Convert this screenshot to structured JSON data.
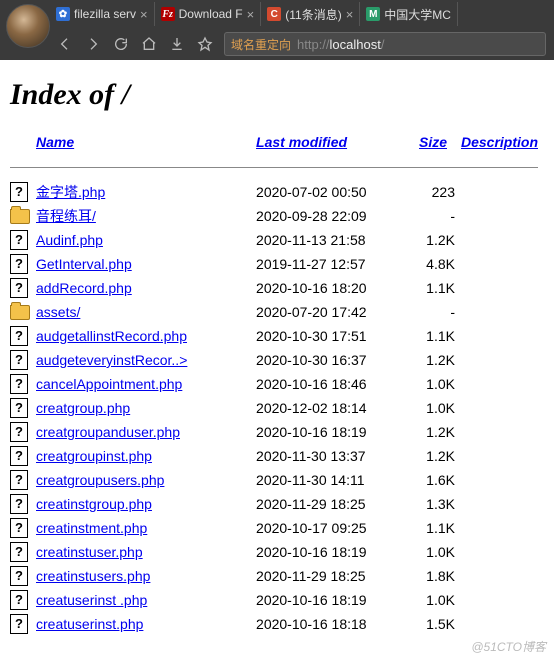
{
  "browser": {
    "tabs": [
      {
        "favicon": "baidu",
        "label": "filezilla serv"
      },
      {
        "favicon": "fz",
        "label": "Download F"
      },
      {
        "favicon": "c",
        "label": "(11条消息)"
      },
      {
        "favicon": "mooc",
        "label": "中国大学MC"
      }
    ],
    "url_redirect_label": "域名重定向",
    "url_scheme": "http://",
    "url_host": "localhost",
    "url_path": "/"
  },
  "page": {
    "heading": "Index of /",
    "columns": {
      "name": "Name",
      "modified": "Last modified",
      "size": "Size",
      "description": "Description"
    },
    "rows": [
      {
        "icon": "file",
        "name": "金字塔.php",
        "modified": "2020-07-02 00:50",
        "size": "223"
      },
      {
        "icon": "folder",
        "name": "音程练耳/",
        "modified": "2020-09-28 22:09",
        "size": "-"
      },
      {
        "icon": "file",
        "name": "Audinf.php",
        "modified": "2020-11-13 21:58",
        "size": "1.2K"
      },
      {
        "icon": "file",
        "name": "GetInterval.php",
        "modified": "2019-11-27 12:57",
        "size": "4.8K"
      },
      {
        "icon": "file",
        "name": "addRecord.php",
        "modified": "2020-10-16 18:20",
        "size": "1.1K"
      },
      {
        "icon": "folder",
        "name": "assets/",
        "modified": "2020-07-20 17:42",
        "size": "-"
      },
      {
        "icon": "file",
        "name": "audgetallinstRecord.php",
        "modified": "2020-10-30 17:51",
        "size": "1.1K"
      },
      {
        "icon": "file",
        "name": "audgeteveryinstRecor..>",
        "modified": "2020-10-30 16:37",
        "size": "1.2K"
      },
      {
        "icon": "file",
        "name": "cancelAppointment.php",
        "modified": "2020-10-16 18:46",
        "size": "1.0K"
      },
      {
        "icon": "file",
        "name": "creatgroup.php",
        "modified": "2020-12-02 18:14",
        "size": "1.0K"
      },
      {
        "icon": "file",
        "name": "creatgroupanduser.php",
        "modified": "2020-10-16 18:19",
        "size": "1.2K"
      },
      {
        "icon": "file",
        "name": "creatgroupinst.php",
        "modified": "2020-11-30 13:37",
        "size": "1.2K"
      },
      {
        "icon": "file",
        "name": "creatgroupusers.php",
        "modified": "2020-11-30 14:11",
        "size": "1.6K"
      },
      {
        "icon": "file",
        "name": "creatinstgroup.php",
        "modified": "2020-11-29 18:25",
        "size": "1.3K"
      },
      {
        "icon": "file",
        "name": "creatinstment.php",
        "modified": "2020-10-17 09:25",
        "size": "1.1K"
      },
      {
        "icon": "file",
        "name": "creatinstuser.php",
        "modified": "2020-10-16 18:19",
        "size": "1.0K"
      },
      {
        "icon": "file",
        "name": "creatinstusers.php",
        "modified": "2020-11-29 18:25",
        "size": "1.8K"
      },
      {
        "icon": "file",
        "name": "creatuserinst .php",
        "modified": "2020-10-16 18:19",
        "size": "1.0K"
      },
      {
        "icon": "file",
        "name": "creatuserinst.php",
        "modified": "2020-10-16 18:18",
        "size": "1.5K"
      }
    ]
  },
  "watermark": "@51CTO博客"
}
